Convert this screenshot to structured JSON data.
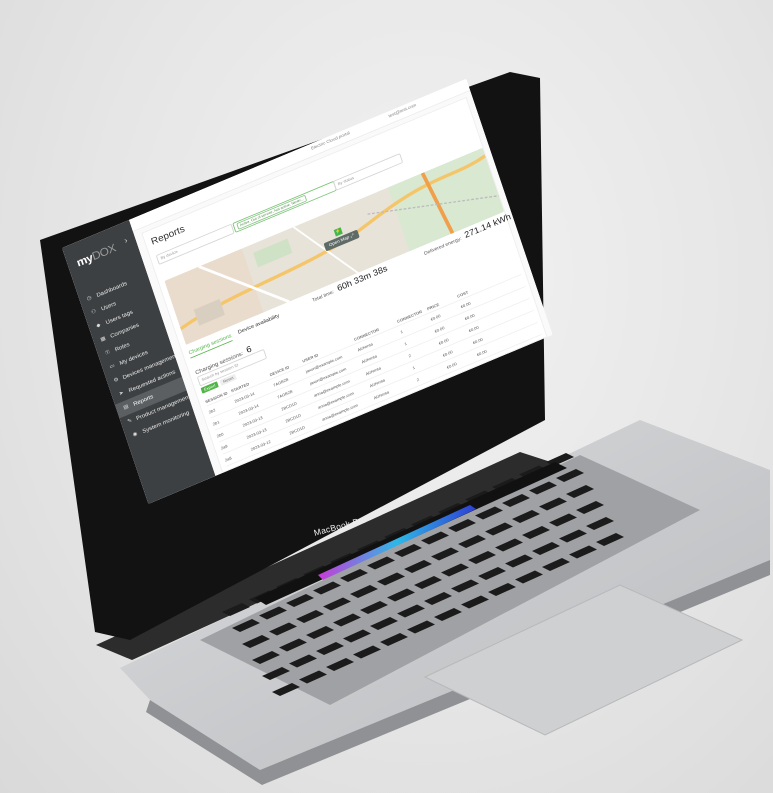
{
  "device": {
    "label": "MacBook Pro"
  },
  "sidebar": {
    "brand_main": "my",
    "brand_sub": "DOX",
    "items": [
      {
        "icon": "dashboard-icon",
        "label": "Dashboards"
      },
      {
        "icon": "users-icon",
        "label": "Users"
      },
      {
        "icon": "tag-icon",
        "label": "Users tags"
      },
      {
        "icon": "building-icon",
        "label": "Companies"
      },
      {
        "icon": "key-icon",
        "label": "Roles"
      },
      {
        "icon": "device-icon",
        "label": "My devices"
      },
      {
        "icon": "gear-icon",
        "label": "Devices management"
      },
      {
        "icon": "send-icon",
        "label": "Requested actions"
      },
      {
        "icon": "report-icon",
        "label": "Reports",
        "active": true
      },
      {
        "icon": "wrench-icon",
        "label": "Product management"
      },
      {
        "icon": "monitor-icon",
        "label": "System monitoring"
      }
    ]
  },
  "topbar": {
    "user_email": "test@test.com",
    "support": "Electric Cloud portal"
  },
  "page": {
    "title": "Reports"
  },
  "filters": {
    "device_placeholder": "By device",
    "status_placeholder": "By status",
    "status_value": "Active, Out of service, Not active, Never..."
  },
  "map": {
    "open_map_label": "Open Map"
  },
  "tabs": [
    {
      "label": "Charging sessions",
      "active": true
    },
    {
      "label": "Device availability",
      "active": false
    }
  ],
  "stats": {
    "total_time_label": "Total time:",
    "total_time_value": "60h 33m 38s",
    "energy_label": "Delivered energy:",
    "energy_value": "271.14 kWh",
    "sessions_label": "Charging sessions:",
    "sessions_value": "6"
  },
  "table": {
    "search_placeholder": "Search by session ID",
    "columns": [
      "SESSION ID",
      "STARTED",
      "DEVICE ID",
      "USER ID",
      "CONNECTOR",
      "CONNECTOR",
      "PRICE",
      "COST",
      ""
    ],
    "actions": {
      "export": "Export",
      "reset": "Reset"
    },
    "rows": [
      [
        "2b2",
        "2023-03-14",
        "7AGB2B",
        "jaxon@example.com",
        "Alzhenta",
        "1",
        "€0.00",
        "€0.00",
        ""
      ],
      [
        "2b1",
        "2023-03-14",
        "7AGB2B",
        "jaxon@example.com",
        "Alzhenta",
        "1",
        "€0.00",
        "€0.00",
        ""
      ],
      [
        "2b0",
        "2023-03-13",
        "2BCD1D",
        "anna@example.com",
        "Alzhenta",
        "2",
        "€0.00",
        "€0.00",
        ""
      ],
      [
        "2a9",
        "2023-03-13",
        "2BCD1D",
        "anna@example.com",
        "Alzhenta",
        "1",
        "€0.00",
        "€0.00",
        ""
      ],
      [
        "2a8",
        "2023-03-12",
        "2BCD1D",
        "anna@example.com",
        "Alzhenta",
        "2",
        "€0.00",
        "€0.00",
        ""
      ]
    ]
  },
  "colors": {
    "accent": "#52b548",
    "sidebar": "#3d4042",
    "active_item": "#5b5f62"
  }
}
